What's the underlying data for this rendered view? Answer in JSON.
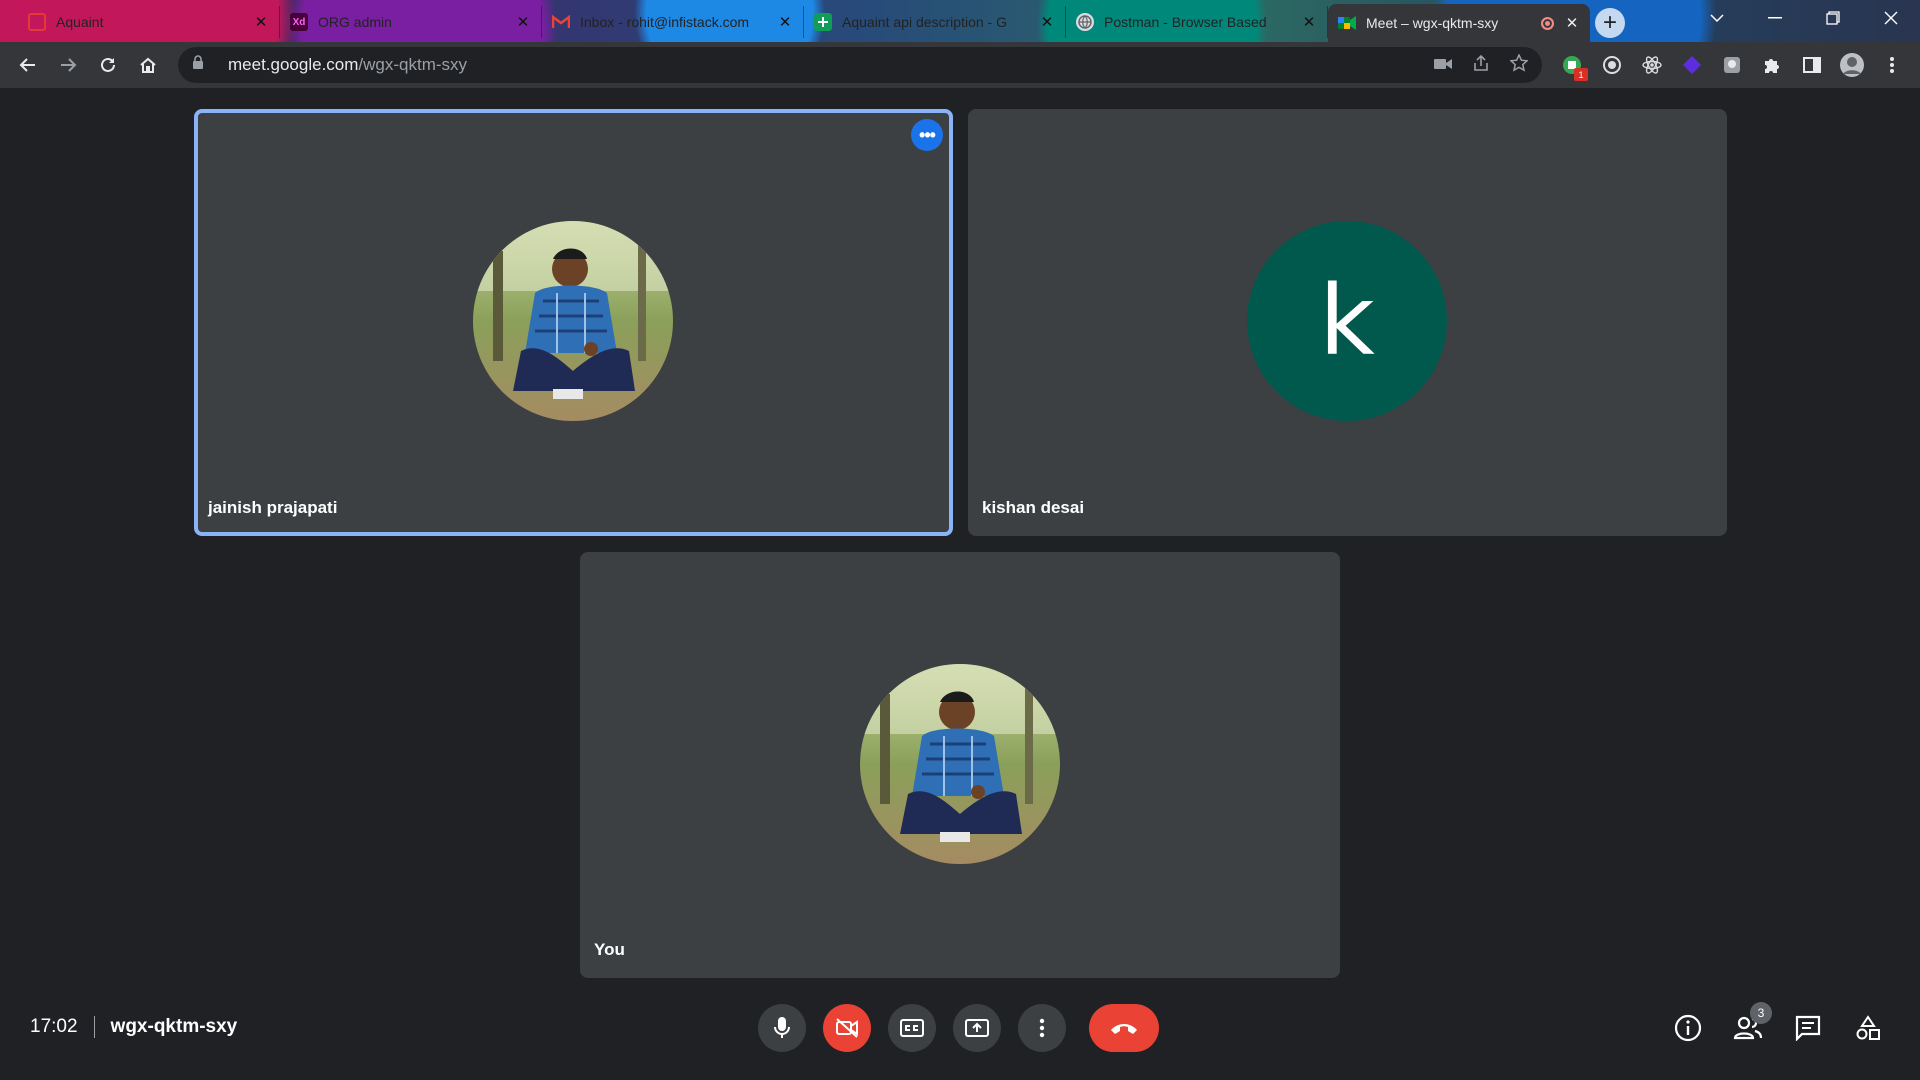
{
  "browser": {
    "tabs": [
      {
        "label": "Aquaint",
        "icon": "aquaint-favicon-icon",
        "color": "#e53935"
      },
      {
        "label": "ORG admin",
        "icon": "xd-favicon-icon",
        "color": "#c2185b",
        "fav_text": "Xd"
      },
      {
        "label": "Inbox - rohit@infistack.com",
        "icon": "gmail-favicon-icon",
        "color": "#ea4335"
      },
      {
        "label": "Aquaint api description - G",
        "icon": "sheets-favicon-icon",
        "color": "#0f9d58"
      },
      {
        "label": "Postman - Browser Based",
        "icon": "globe-favicon-icon",
        "color": "#9aa0a6"
      },
      {
        "label": "Meet – wgx-qktm-sxy",
        "icon": "meet-favicon-icon",
        "color": "#00832d",
        "active": true
      }
    ],
    "url_host": "meet.google.com",
    "url_path": "/wgx-qktm-sxy",
    "extension_badge": "1"
  },
  "meet": {
    "participants": [
      {
        "name": "jainish prajapati",
        "avatar": "photo",
        "speaking": true
      },
      {
        "name": "kishan desai",
        "avatar": "letter",
        "initial": "k"
      },
      {
        "name": "You",
        "avatar": "photo"
      }
    ],
    "time": "17:02",
    "code": "wgx-qktm-sxy",
    "people_count": "3",
    "more_options_glyph": "•••"
  },
  "colors": {
    "accent_blue": "#1a73e8",
    "speaking_outline": "#8ab4f8",
    "hangup_red": "#ea4335",
    "avatar_green": "#00594c"
  }
}
